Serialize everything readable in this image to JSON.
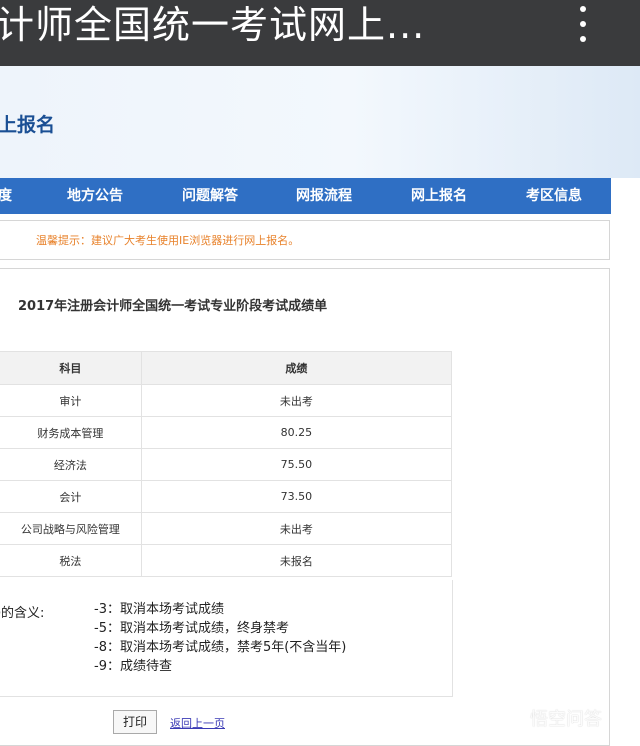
{
  "header": {
    "title": "计师全国统一考试网上...",
    "menu_icon": "more-vertical-icon"
  },
  "banner": {
    "site_title": "上报名"
  },
  "nav": {
    "items": [
      {
        "label": "度"
      },
      {
        "label": "地方公告"
      },
      {
        "label": "问题解答"
      },
      {
        "label": "网报流程"
      },
      {
        "label": "网上报名"
      },
      {
        "label": "考区信息"
      }
    ]
  },
  "notice": {
    "text": "温馨提示：建议广大考生使用IE浏览器进行网上报名。"
  },
  "scores": {
    "title": "2017年注册会计师全国统一考试专业阶段考试成绩单",
    "headers": [
      "科目",
      "成绩"
    ],
    "rows": [
      {
        "subject": "审计",
        "score": "未出考"
      },
      {
        "subject": "财务成本管理",
        "score": "80.25"
      },
      {
        "subject": "经济法",
        "score": "75.50"
      },
      {
        "subject": "会计",
        "score": "73.50"
      },
      {
        "subject": "公司战略与风险管理",
        "score": "未出考"
      },
      {
        "subject": "税法",
        "score": "未报名"
      }
    ]
  },
  "legend": {
    "label": "码的含义:",
    "items": [
      "-3：取消本场考试成绩",
      "-5：取消本场考试成绩，终身禁考",
      "-8：取消本场考试成绩，禁考5年(不含当年)",
      "-9：成绩待查"
    ]
  },
  "actions": {
    "print_label": "打印",
    "back_label": "返回上一页"
  },
  "watermark": {
    "text": "悟空问答"
  },
  "colors": {
    "nav_bg": "#2f6fc4",
    "site_title": "#1a4f94",
    "notice_text": "#e8822b",
    "topbar_bg": "#3a3b3d"
  }
}
